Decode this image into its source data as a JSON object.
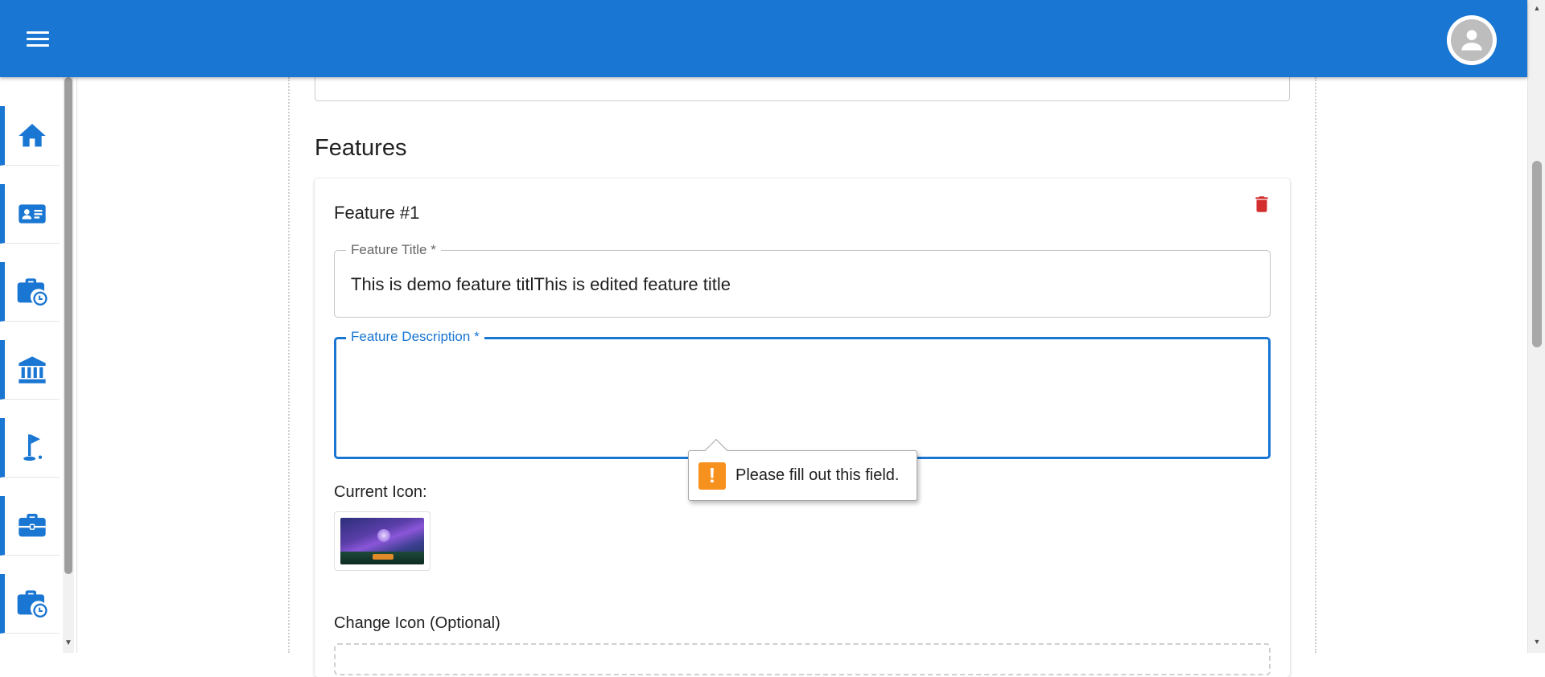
{
  "sidebar": {
    "items": [
      {
        "icon": "home-icon"
      },
      {
        "icon": "contact-card-icon"
      },
      {
        "icon": "briefcase-clock-icon"
      },
      {
        "icon": "bank-icon"
      },
      {
        "icon": "golf-flag-icon"
      },
      {
        "icon": "briefcase-icon"
      },
      {
        "icon": "briefcase-clock-icon"
      }
    ]
  },
  "main": {
    "section_title": "Features",
    "feature": {
      "heading": "Feature #1",
      "title_label": "Feature Title *",
      "title_value": "This is demo feature titlThis is edited feature title",
      "description_label": "Feature Description *",
      "description_value": "",
      "current_icon_label": "Current Icon:",
      "change_icon_label": "Change Icon (Optional)"
    }
  },
  "validation_tooltip": {
    "message": "Please fill out this field.",
    "icon": "!"
  },
  "colors": {
    "primary": "#1976d2",
    "delete": "#d32f2f",
    "warning": "#f6911e"
  }
}
